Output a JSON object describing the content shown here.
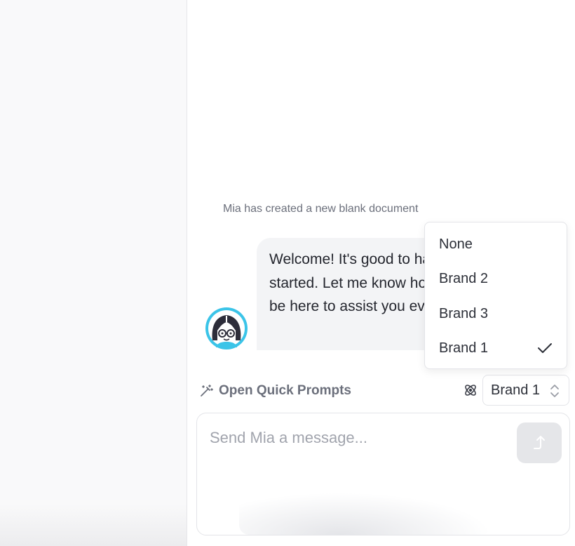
{
  "sidebar": {},
  "chat": {
    "system_note": "Mia has created a new blank document",
    "assistant_message": "Welcome! It's good to have you here. Let's get started. Let me know how I can help you, and I'll be here to assist you every step of the way.",
    "avatar_icon": "mia-avatar-icon"
  },
  "toolbar": {
    "quick_prompts_label": "Open Quick Prompts",
    "quick_prompts_icon": "magic-wand-icon",
    "brand_icon": "atom-icon",
    "brand_selected": "Brand 1"
  },
  "brand_dropdown": {
    "options": [
      "None",
      "Brand 2",
      "Brand 3",
      "Brand 1"
    ],
    "selected": "Brand 1"
  },
  "composer": {
    "placeholder": "Send Mia a message...",
    "value": "",
    "send_icon": "send-arrow-icon"
  },
  "colors": {
    "avatar_ring": "#3bc4e8",
    "bubble_bg": "#f3f4f6",
    "muted_text": "#6b6f7b"
  }
}
